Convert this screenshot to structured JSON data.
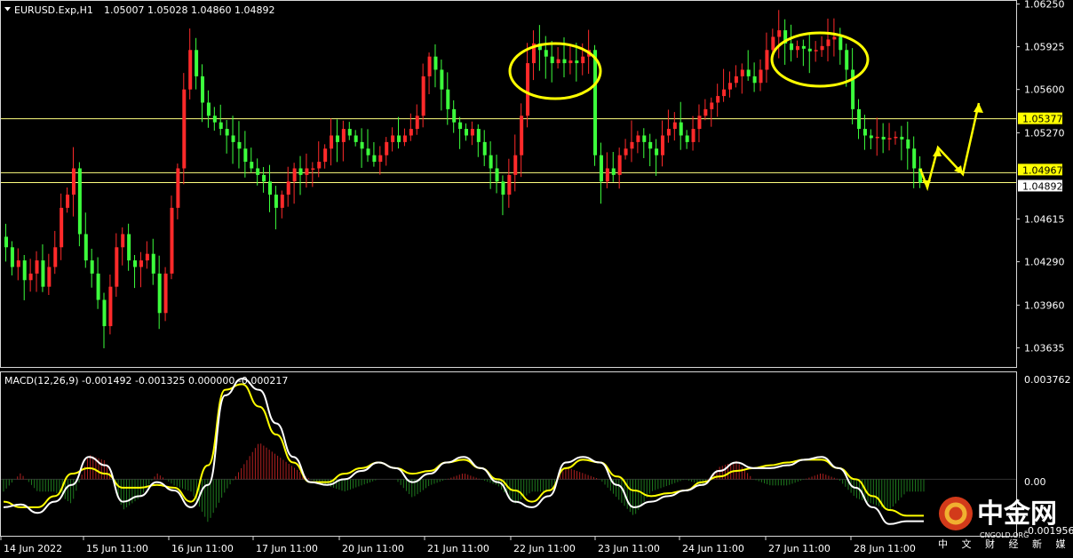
{
  "header": {
    "instrument": "EURUSD.Exp,H1",
    "ohlc": "1.05007 1.05028 1.04860 1.04892"
  },
  "macd": {
    "label": "MACD(12,26,9) -0.001492 -0.001325 0.000000 -0.000217",
    "top_label": "0.003762",
    "zero_label": "0.00",
    "bottom_label": "-0.001956"
  },
  "watermark": {
    "brand": "中金网",
    "brand_en": "CNGOLD.ORG",
    "tagline": "中 文 财 经 新 媒 体"
  },
  "colors": {
    "background": "#000000",
    "bull_candle": "#ff2a2a",
    "bear_candle": "#3cff3c",
    "horizontal_lines": "#ffff80",
    "price_tag": "#ffff00",
    "annotation": "#ffff00",
    "macd_line": "#ffffff",
    "signal_line": "#ffff00",
    "hist_pos": "#b02020",
    "hist_neg": "#1e7a1e"
  },
  "chart_data": [
    {
      "type": "candlestick",
      "title": "EURUSD.Exp,H1",
      "timeframe": "H1",
      "x_labels": [
        "14 Jun 2022",
        "15 Jun 11:00",
        "16 Jun 11:00",
        "17 Jun 11:00",
        "20 Jun 11:00",
        "21 Jun 11:00",
        "22 Jun 11:00",
        "23 Jun 11:00",
        "24 Jun 11:00",
        "27 Jun 11:00",
        "28 Jun 11:00"
      ],
      "y_ticks": [
        "1.06250",
        "1.05925",
        "1.05600",
        "1.05270",
        "1.04615",
        "1.04290",
        "1.03960",
        "1.03635"
      ],
      "ylim": [
        1.0351,
        1.0626
      ],
      "current": {
        "open": 1.05007,
        "high": 1.05028,
        "low": 1.0486,
        "close": 1.04892
      },
      "horizontal_levels": [
        {
          "label": "1.05377",
          "value": 1.05377
        },
        {
          "label": "1.04967",
          "value": 1.04967
        },
        {
          "label": "1.04892",
          "value": 1.04892
        }
      ],
      "price_path": [
        1.044,
        1.0425,
        1.043,
        1.0415,
        1.042,
        1.043,
        1.041,
        1.0425,
        1.044,
        1.047,
        1.048,
        1.05,
        1.045,
        1.043,
        1.042,
        1.04,
        1.038,
        1.041,
        1.044,
        1.045,
        1.043,
        1.0425,
        1.043,
        1.0435,
        1.042,
        1.039,
        1.042,
        1.047,
        1.05,
        1.056,
        1.059,
        1.057,
        1.055,
        1.054,
        1.0535,
        1.053,
        1.0525,
        1.052,
        1.0515,
        1.0505,
        1.05,
        1.0495,
        1.049,
        1.048,
        1.047,
        1.048,
        1.049,
        1.05,
        1.0495,
        1.05,
        1.05,
        1.0505,
        1.0515,
        1.0525,
        1.052,
        1.053,
        1.0525,
        1.052,
        1.0515,
        1.051,
        1.0505,
        1.051,
        1.052,
        1.0525,
        1.052,
        1.0525,
        1.053,
        1.054,
        1.057,
        1.0585,
        1.0575,
        1.056,
        1.0545,
        1.0535,
        1.053,
        1.0525,
        1.053,
        1.052,
        1.051,
        1.05,
        1.049,
        1.048,
        1.0495,
        1.051,
        1.054,
        1.058,
        1.0595,
        1.059,
        1.0585,
        1.058,
        1.0583,
        1.058,
        1.0582,
        1.058,
        1.0585,
        1.059,
        1.051,
        1.049,
        1.05,
        1.0495,
        1.051,
        1.0515,
        1.052,
        1.0525,
        1.052,
        1.0515,
        1.051,
        1.0525,
        1.053,
        1.0535,
        1.0525,
        1.052,
        1.053,
        1.054,
        1.0545,
        1.055,
        1.0555,
        1.056,
        1.0565,
        1.057,
        1.0575,
        1.057,
        1.0565,
        1.0575,
        1.059,
        1.06,
        1.0605,
        1.0595,
        1.059,
        1.0593,
        1.0591,
        1.0589,
        1.059,
        1.0593,
        1.0598,
        1.06,
        1.059,
        1.0575,
        1.0545,
        1.053,
        1.0525,
        1.0523,
        1.0524,
        1.0522,
        1.0523,
        1.0524,
        1.0522,
        1.0515,
        1.05,
        1.0489
      ],
      "annotations": [
        "ellipse around 22 Jun high",
        "ellipse around 27 Jun high",
        "projected zig-zag arrow path"
      ]
    },
    {
      "type": "line",
      "title": "MACD(12,26,9)",
      "params": [
        12,
        26,
        9
      ],
      "values": {
        "main": -0.001492,
        "signal": -0.001325,
        "osma": 0.0,
        "other": -0.000217
      },
      "ylim": [
        -0.001956,
        0.003762
      ],
      "series": [
        {
          "name": "MACD",
          "values": [
            -0.001,
            -0.0009,
            -0.0012,
            -0.0008,
            -0.0002,
            0.0008,
            0.0005,
            -0.0008,
            -0.0006,
            -0.0001,
            -0.0004,
            -0.001,
            -0.0002,
            0.003,
            0.0036,
            0.0032,
            0.002,
            0.0008,
            -0.0001,
            -0.0002,
            0.0,
            0.0003,
            0.0006,
            0.0004,
            -0.0001,
            0.0002,
            0.0006,
            0.0008,
            0.0004,
            -0.0001,
            -0.0008,
            -0.001,
            -0.0006,
            0.0006,
            0.0008,
            0.0006,
            -0.0002,
            -0.001,
            -0.0008,
            -0.0006,
            -0.0004,
            -0.0002,
            0.0003,
            0.0006,
            0.0004,
            0.0004,
            0.0005,
            0.0007,
            0.0008,
            0.0004,
            -0.0003,
            -0.001,
            -0.0016,
            -0.0015,
            -0.0015
          ]
        },
        {
          "name": "Signal",
          "values": [
            -0.0008,
            -0.001,
            -0.001,
            -0.0006,
            0.0002,
            0.0004,
            0.0002,
            -0.0003,
            -0.0003,
            -0.0002,
            -0.0003,
            -0.0008,
            0.0005,
            0.0032,
            0.0034,
            0.0026,
            0.0016,
            0.0006,
            -0.0001,
            -0.0001,
            0.0002,
            0.0004,
            0.0006,
            0.0004,
            0.0002,
            0.0003,
            0.0006,
            0.0007,
            0.0004,
            0.0,
            -0.0004,
            -0.0008,
            -0.0004,
            0.0004,
            0.0007,
            0.0006,
            0.0001,
            -0.0004,
            -0.0006,
            -0.0005,
            -0.0004,
            -0.0001,
            0.0001,
            0.0003,
            0.0004,
            0.0005,
            0.0006,
            0.0007,
            0.0007,
            0.0004,
            0.0,
            -0.0006,
            -0.0011,
            -0.0013,
            -0.0013
          ]
        }
      ]
    }
  ]
}
